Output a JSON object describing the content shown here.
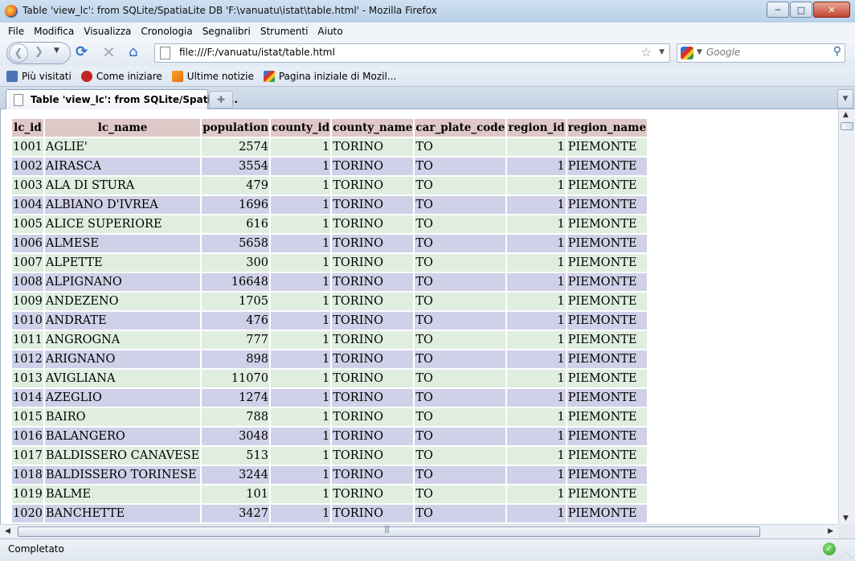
{
  "window": {
    "title": "Table 'view_lc': from SQLite/SpatiaLite DB 'F:\\vanuatu\\istat\\table.html' - Mozilla Firefox",
    "min_glyph": "─",
    "max_glyph": "□",
    "close_glyph": "✕"
  },
  "menu": [
    "File",
    "Modifica",
    "Visualizza",
    "Cronologia",
    "Segnalibri",
    "Strumenti",
    "Aiuto"
  ],
  "nav": {
    "url": "file:///F:/vanuatu/istat/table.html",
    "search_placeholder": "Google"
  },
  "bookmarks": [
    "Più visitati",
    "Come iniziare",
    "Ultime notizie",
    "Pagina iniziale di Mozil..."
  ],
  "tab": {
    "label": "Table 'view_lc': from SQLite/SpatiaLi..."
  },
  "table": {
    "headers": [
      "lc_id",
      "lc_name",
      "population",
      "county_id",
      "county_name",
      "car_plate_code",
      "region_id",
      "region_name"
    ],
    "rows": [
      [
        "1001",
        "AGLIE'",
        "2574",
        "1",
        "TORINO",
        "TO",
        "1",
        "PIEMONTE"
      ],
      [
        "1002",
        "AIRASCA",
        "3554",
        "1",
        "TORINO",
        "TO",
        "1",
        "PIEMONTE"
      ],
      [
        "1003",
        "ALA DI STURA",
        "479",
        "1",
        "TORINO",
        "TO",
        "1",
        "PIEMONTE"
      ],
      [
        "1004",
        "ALBIANO D'IVREA",
        "1696",
        "1",
        "TORINO",
        "TO",
        "1",
        "PIEMONTE"
      ],
      [
        "1005",
        "ALICE SUPERIORE",
        "616",
        "1",
        "TORINO",
        "TO",
        "1",
        "PIEMONTE"
      ],
      [
        "1006",
        "ALMESE",
        "5658",
        "1",
        "TORINO",
        "TO",
        "1",
        "PIEMONTE"
      ],
      [
        "1007",
        "ALPETTE",
        "300",
        "1",
        "TORINO",
        "TO",
        "1",
        "PIEMONTE"
      ],
      [
        "1008",
        "ALPIGNANO",
        "16648",
        "1",
        "TORINO",
        "TO",
        "1",
        "PIEMONTE"
      ],
      [
        "1009",
        "ANDEZENO",
        "1705",
        "1",
        "TORINO",
        "TO",
        "1",
        "PIEMONTE"
      ],
      [
        "1010",
        "ANDRATE",
        "476",
        "1",
        "TORINO",
        "TO",
        "1",
        "PIEMONTE"
      ],
      [
        "1011",
        "ANGROGNA",
        "777",
        "1",
        "TORINO",
        "TO",
        "1",
        "PIEMONTE"
      ],
      [
        "1012",
        "ARIGNANO",
        "898",
        "1",
        "TORINO",
        "TO",
        "1",
        "PIEMONTE"
      ],
      [
        "1013",
        "AVIGLIANA",
        "11070",
        "1",
        "TORINO",
        "TO",
        "1",
        "PIEMONTE"
      ],
      [
        "1014",
        "AZEGLIO",
        "1274",
        "1",
        "TORINO",
        "TO",
        "1",
        "PIEMONTE"
      ],
      [
        "1015",
        "BAIRO",
        "788",
        "1",
        "TORINO",
        "TO",
        "1",
        "PIEMONTE"
      ],
      [
        "1016",
        "BALANGERO",
        "3048",
        "1",
        "TORINO",
        "TO",
        "1",
        "PIEMONTE"
      ],
      [
        "1017",
        "BALDISSERO CANAVESE",
        "513",
        "1",
        "TORINO",
        "TO",
        "1",
        "PIEMONTE"
      ],
      [
        "1018",
        "BALDISSERO TORINESE",
        "3244",
        "1",
        "TORINO",
        "TO",
        "1",
        "PIEMONTE"
      ],
      [
        "1019",
        "BALME",
        "101",
        "1",
        "TORINO",
        "TO",
        "1",
        "PIEMONTE"
      ],
      [
        "1020",
        "BANCHETTE",
        "3427",
        "1",
        "TORINO",
        "TO",
        "1",
        "PIEMONTE"
      ]
    ]
  },
  "status": {
    "text": "Completato"
  },
  "colors": {
    "header_bg": "#dfc8c8",
    "row_odd_bg": "#dfeedf",
    "row_even_bg": "#d0d1e8"
  }
}
